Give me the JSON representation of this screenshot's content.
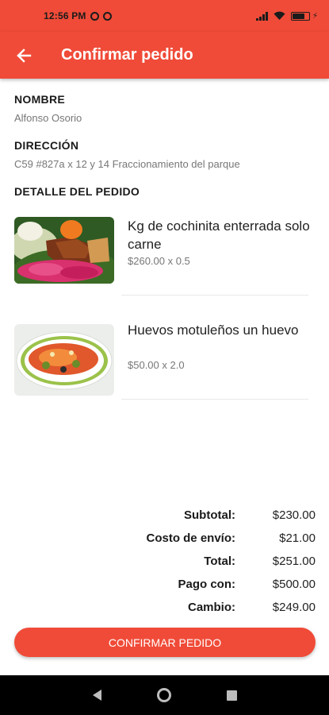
{
  "status_bar": {
    "time": "12:56 PM"
  },
  "app_bar": {
    "title": "Confirmar pedido",
    "back_icon": "arrow-left-icon"
  },
  "customer": {
    "name_label": "NOMBRE",
    "name": "Alfonso Osorio",
    "address_label": "DIRECCIÓN",
    "address": "C59 #827a x 12 y 14 Fraccionamiento del parque"
  },
  "order": {
    "section_label": "DETALLE DEL PEDIDO",
    "items": [
      {
        "name": "Kg de cochinita enterrada solo carne",
        "price_line": "$260.00 x 0.5"
      },
      {
        "name": "Huevos motuleños un huevo",
        "price_line": "$50.00 x 2.0"
      }
    ]
  },
  "totals": {
    "subtotal_label": "Subtotal:",
    "subtotal": "$230.00",
    "shipping_label": "Costo de envío:",
    "shipping": "$21.00",
    "total_label": "Total:",
    "total": "$251.00",
    "paid_label": "Pago con:",
    "paid": "$500.00",
    "change_label": "Cambio:",
    "change": "$249.00"
  },
  "confirm_button": "CONFIRMAR PEDIDO",
  "colors": {
    "accent": "#f04b38",
    "status": "#ef4b38"
  }
}
